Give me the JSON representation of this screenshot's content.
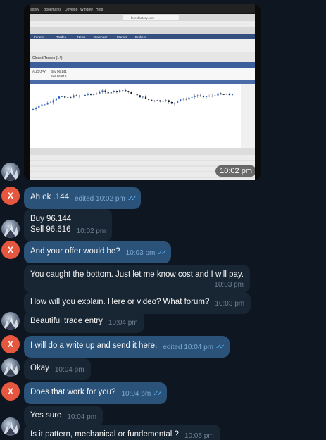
{
  "photo": {
    "time": "10:02 pm",
    "screen": {
      "menubar": [
        "History",
        "Bookmarks",
        "Develop",
        "Window",
        "Help"
      ],
      "site": "forexfactory.com",
      "nav_tabs": [
        "Forums",
        "Trades",
        "News",
        "Calendar",
        "Market",
        "Brokers"
      ],
      "panel_title": "Closed Trades (14)",
      "trades": [
        {
          "pair": "AUD/JPY",
          "side": "Buy 96.141",
          "close": "Sell 96.616"
        }
      ],
      "chart_colors": {
        "up": "#2a64c8",
        "down": "#1a1a1a",
        "bg": "#ffffff"
      }
    }
  },
  "messages": [
    {
      "from": "them",
      "text": "Ah ok .144",
      "time": "10:02 pm",
      "edited": true,
      "read": true
    },
    {
      "from": "me",
      "lines": [
        "Buy 96.144",
        "Sell 96.616"
      ],
      "time": "10:02 pm"
    },
    {
      "from": "them",
      "text": "And your offer would be?",
      "time": "10:03 pm",
      "read": true
    },
    {
      "from": "me",
      "text": "You caught the bottom.  Just let me know cost and I will pay.",
      "time": "10:03 pm"
    },
    {
      "from": "me",
      "text": "How will you explain.  Here or video?  What forum?",
      "time": "10:03 pm"
    },
    {
      "from": "me",
      "text": "Beautiful trade entry",
      "time": "10:04 pm"
    },
    {
      "from": "them",
      "text": "I will do a write up and send it here.",
      "time": "10:04 pm",
      "edited": true,
      "read": true
    },
    {
      "from": "me",
      "text": "Okay",
      "time": "10:04 pm"
    },
    {
      "from": "them",
      "text": "Does that work for you?",
      "time": "10:04 pm",
      "read": true
    },
    {
      "from": "me",
      "text": "Yes sure",
      "time": "10:04 pm"
    },
    {
      "from": "me",
      "text": "Is it pattern, mechanical or fundemental ?",
      "time": "10:05 pm"
    }
  ],
  "labels": {
    "edited": "edited"
  },
  "avatars": {
    "them_initial": "X"
  },
  "colors": {
    "background": "#0e1621",
    "incoming": "#182533",
    "outgoing": "#2b5278",
    "avatar_initial": "#e5573f",
    "read_check": "#4fb4f5"
  }
}
